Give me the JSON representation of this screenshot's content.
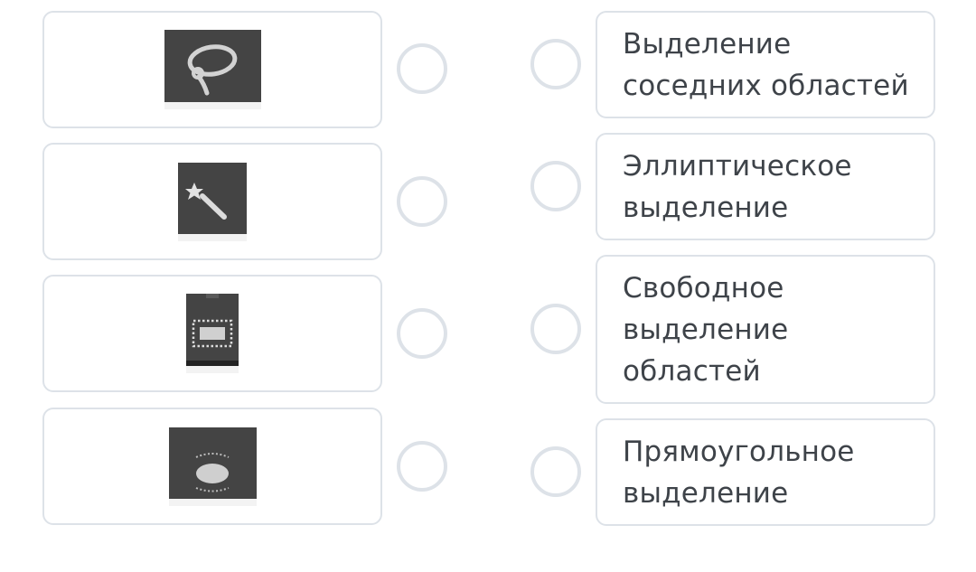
{
  "left_items": [
    {
      "icon": "lasso-tool-icon"
    },
    {
      "icon": "magic-wand-tool-icon"
    },
    {
      "icon": "rectangular-marquee-tool-icon"
    },
    {
      "icon": "elliptical-marquee-tool-icon"
    }
  ],
  "right_items": [
    {
      "label": "Выделение\nсоседних областей"
    },
    {
      "label": "Эллиптическое\nвыделение"
    },
    {
      "label": "Свободное\nвыделение\nобластей"
    },
    {
      "label": "Прямоугольное\nвыделение"
    }
  ],
  "colors": {
    "card_border": "#dde2e8",
    "text": "#3e4349",
    "icon_background": "#444444",
    "icon_foreground": "#cfcfcf"
  }
}
